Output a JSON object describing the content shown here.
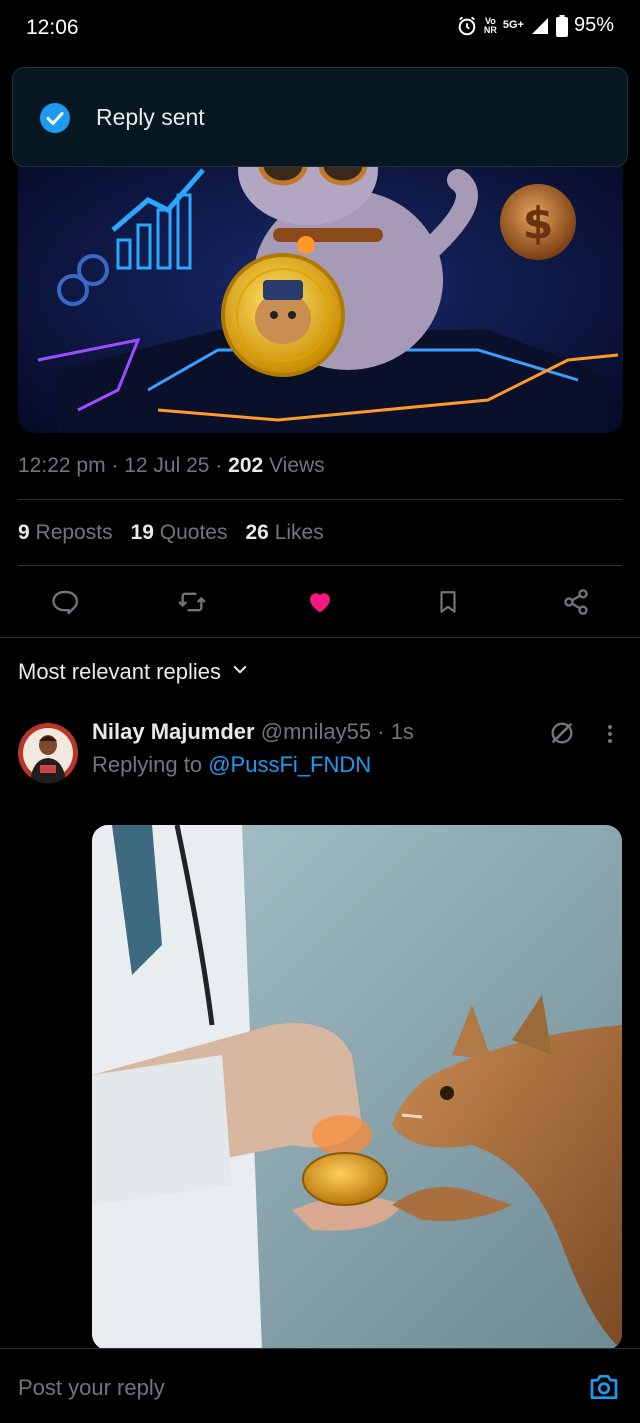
{
  "status_bar": {
    "time": "12:06",
    "network_top": "Vo",
    "network_bottom": "NR",
    "network_type": "5G+",
    "battery": "95%"
  },
  "toast": {
    "icon": "check-circle-icon",
    "text": "Reply sent"
  },
  "tweet": {
    "time": "12:22 pm",
    "date": "12 Jul 25",
    "views_count": "202",
    "views_label": "Views",
    "reposts_count": "9",
    "reposts_label": "Reposts",
    "quotes_count": "19",
    "quotes_label": "Quotes",
    "likes_count": "26",
    "likes_label": "Likes",
    "separator": " · "
  },
  "actions": {
    "reply_icon": "reply-icon",
    "repost_icon": "repost-icon",
    "like_icon": "heart-filled-icon",
    "bookmark_icon": "bookmark-icon",
    "share_icon": "share-icon",
    "like_color": "#f91880"
  },
  "replies": {
    "sort_label": "Most relevant replies"
  },
  "reply": {
    "author_name": "Nilay Majumder",
    "author_handle": "@mnilay55",
    "time_ago": "1s",
    "replying_prefix": "Replying to",
    "replying_handle": "@PussFi_FNDN"
  },
  "composer": {
    "placeholder": "Post your reply"
  },
  "colors": {
    "accent": "#1d9bf0",
    "background": "#000000",
    "muted": "#71767b"
  }
}
